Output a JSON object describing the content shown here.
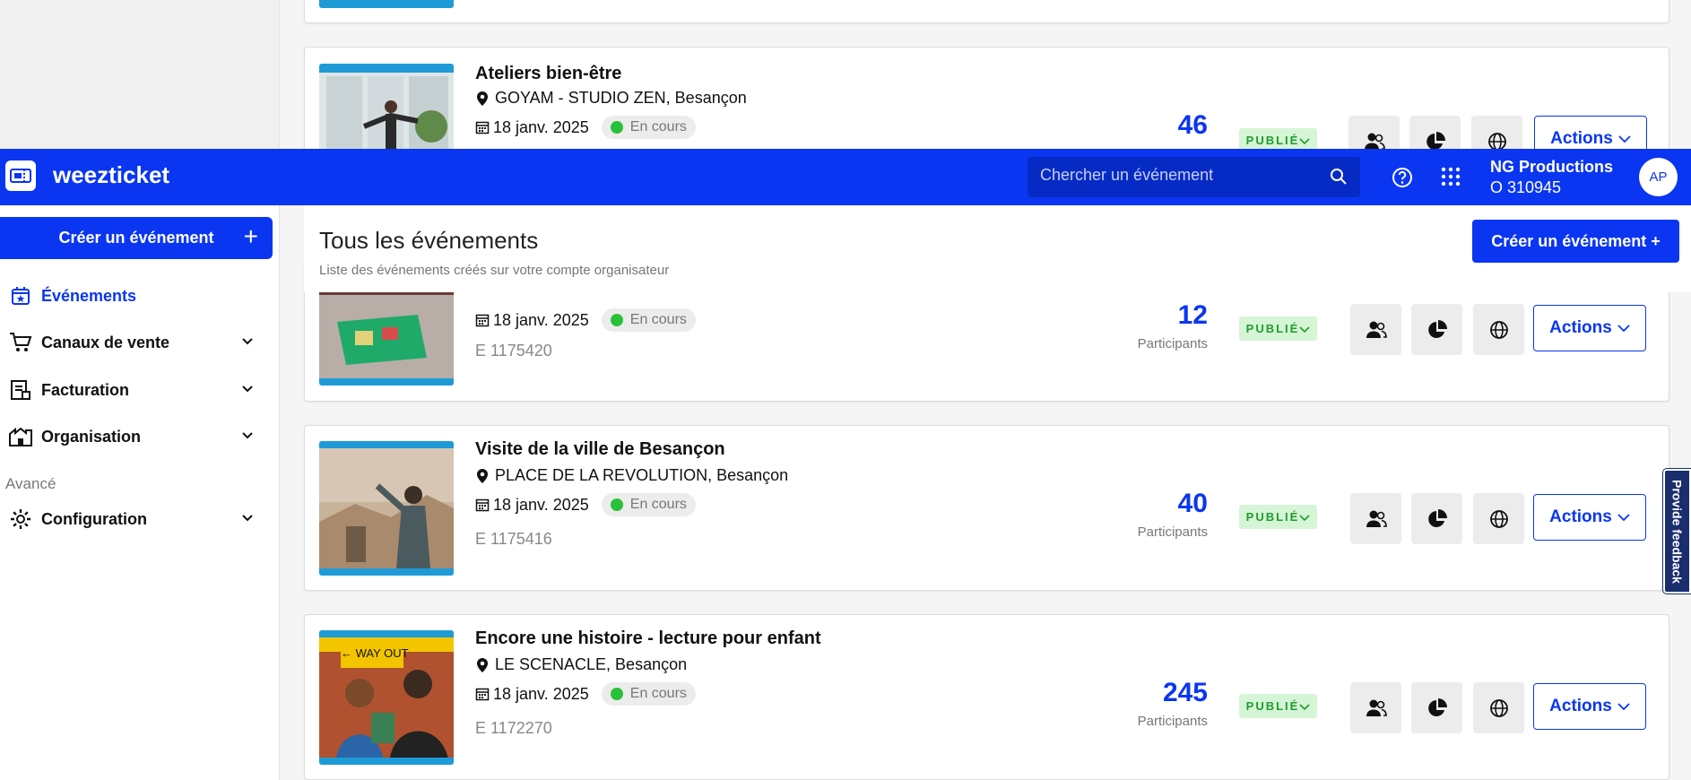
{
  "app": {
    "brand": "weezticket"
  },
  "header": {
    "search_placeholder": "Chercher un événement",
    "org_name": "NG Productions",
    "org_id": "O 310945",
    "avatar": "AP"
  },
  "sidebar": {
    "create_label": "Créer un événement",
    "items": [
      {
        "label": "Événements",
        "icon": "calendar-star-icon",
        "active": true
      },
      {
        "label": "Canaux de vente",
        "icon": "cart-icon"
      },
      {
        "label": "Facturation",
        "icon": "invoice-icon"
      },
      {
        "label": "Organisation",
        "icon": "building-icon"
      }
    ],
    "section_label": "Avancé",
    "config_label": "Configuration"
  },
  "main": {
    "title": "Tous les événements",
    "subtitle": "Liste des événements créés sur votre compte organisateur",
    "create_label": "Créer un événement +"
  },
  "events": [
    {
      "title": "Ateliers bien-être",
      "location": "GOYAM - STUDIO ZEN, Besançon",
      "date": "18 janv. 2025",
      "status": "En cours",
      "count": "46",
      "badge": "PUBLIÉ",
      "actions": "Actions"
    },
    {
      "date": "18 janv. 2025",
      "status": "En cours",
      "code": "E 1175420",
      "count": "12",
      "count_label": "Participants",
      "badge": "PUBLIÉ",
      "actions": "Actions"
    },
    {
      "title": "Visite de la ville de Besançon",
      "location": "PLACE DE LA REVOLUTION, Besançon",
      "date": "18 janv. 2025",
      "status": "En cours",
      "code": "E 1175416",
      "count": "40",
      "count_label": "Participants",
      "badge": "PUBLIÉ",
      "actions": "Actions"
    },
    {
      "title": "Encore une histoire - lecture pour enfant",
      "location": "LE SCENACLE, Besançon",
      "date": "18 janv. 2025",
      "status": "En cours",
      "code": "E 1172270",
      "count": "245",
      "count_label": "Participants",
      "badge": "PUBLIÉ",
      "actions": "Actions"
    }
  ],
  "thumb_text": {
    "way_out": "← WAY OUT"
  },
  "feedback_label": "Provide feedback",
  "colors": {
    "primary": "#0a36f2",
    "published_bg": "#d6f5d6",
    "published_text": "#1f9d2d",
    "status_dot": "#2ac13a"
  }
}
